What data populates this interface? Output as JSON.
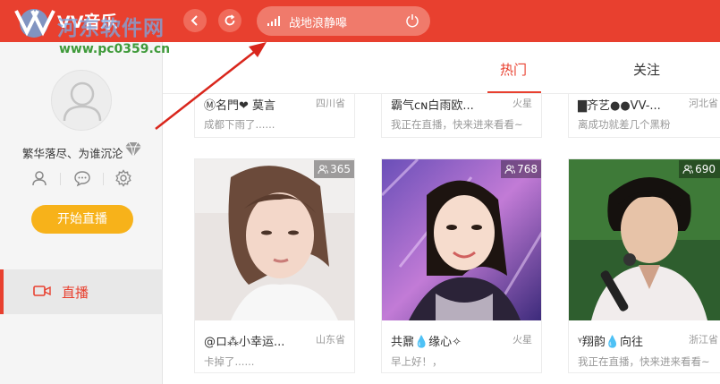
{
  "app": {
    "title": "VV音乐",
    "watermark": "河东软件网",
    "watermark_url": "www.pc0359.cn"
  },
  "header": {
    "now_playing": "战地浪静嗥"
  },
  "sidebar": {
    "username": "繁华落尽、为谁沉沦",
    "start_live_label": "开始直播",
    "items": [
      {
        "label": "直播",
        "icon": "video-camera-icon"
      }
    ]
  },
  "tabs": [
    {
      "label": "热门",
      "active": true
    },
    {
      "label": "关注",
      "active": false
    }
  ],
  "cards_top": [
    {
      "name": "Ⓜ名門❤ 莫言",
      "location": "四川省",
      "message": "成都下雨了......"
    },
    {
      "name": "霸气ᴄɴ白雨欧...",
      "location": "火星",
      "message": "我正在直播，快来进来看看~"
    },
    {
      "name": "▇齐艺●●VV-...",
      "location": "河北省",
      "message": "离成功就差几个黑粉"
    }
  ],
  "cards": [
    {
      "viewers": "365",
      "name": "@ロ⁂小幸运...",
      "location": "山东省",
      "message": "卡掉了......"
    },
    {
      "viewers": "768",
      "name": "共鼐💧缘心✧",
      "location": "火星",
      "message": "早上好！，"
    },
    {
      "viewers": "690",
      "name": "ᵞ翔韵💧向往",
      "location": "浙江省",
      "message": "我正在直播，快来进来看看~"
    }
  ],
  "colors": {
    "brand": "#e8402f",
    "accent_button": "#f7b21a"
  }
}
